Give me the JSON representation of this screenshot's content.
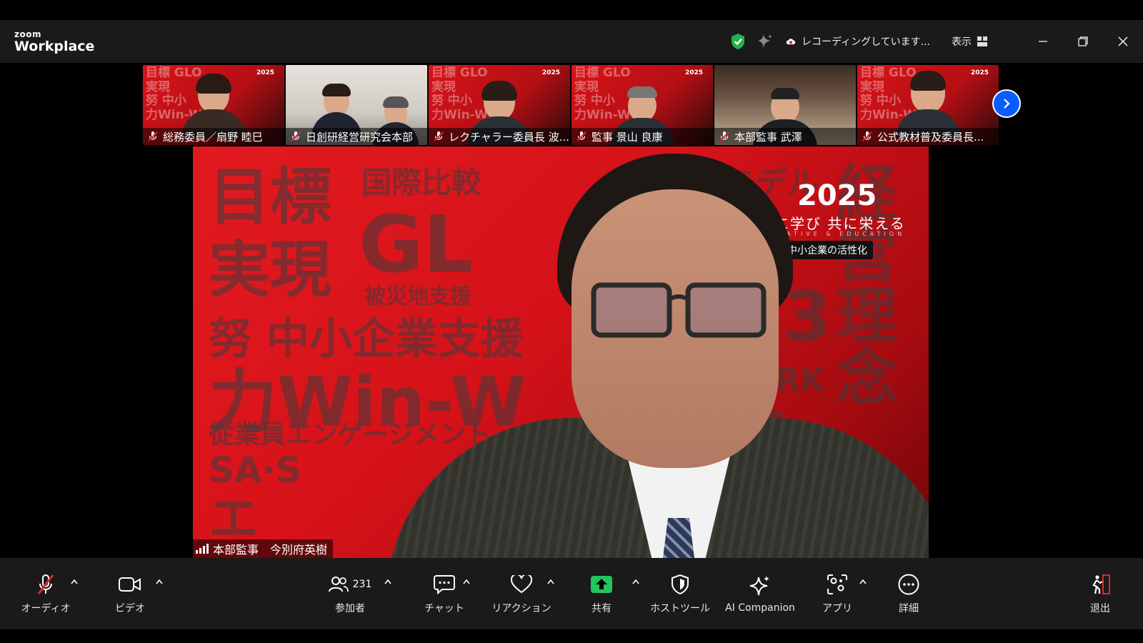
{
  "app": {
    "brand_top": "zoom",
    "brand_name": "Workplace"
  },
  "titlebar": {
    "recording_text": "レコーディングしています...",
    "view_label": "表示"
  },
  "filmstrip": [
    {
      "name": "総務委員／扇野 睦巳",
      "background": "red"
    },
    {
      "name": "日創研経営研究会本部",
      "background": "room"
    },
    {
      "name": "レクチャラー委員長 波...",
      "background": "red"
    },
    {
      "name": "監事 景山 良康",
      "background": "red"
    },
    {
      "name": "本部監事 武澤",
      "background": "room2"
    },
    {
      "name": "公式教材普及委員長...",
      "background": "red"
    }
  ],
  "main_video": {
    "speaker_name": "本部監事　今別府英樹",
    "year": "2025",
    "slogan": "共に学び 共に栄える",
    "subtitle": "CREATIVE & EDUCATION",
    "badge": "中小企業の活性化"
  },
  "toolbar": {
    "audio_label": "オーディオ",
    "video_label": "ビデオ",
    "participants_label": "参加者",
    "participants_count": "231",
    "chat_label": "チャット",
    "reaction_label": "リアクション",
    "share_label": "共有",
    "host_tools_label": "ホストツール",
    "ai_companion_label": "AI Companion",
    "apps_label": "アプリ",
    "more_label": "詳細",
    "leave_label": "退出"
  },
  "colors": {
    "share_green": "#22c55e",
    "next_blue": "#0b5cff",
    "mute_red": "#e02828",
    "shield_green": "#22b34a",
    "leave_red": "#e02828"
  }
}
